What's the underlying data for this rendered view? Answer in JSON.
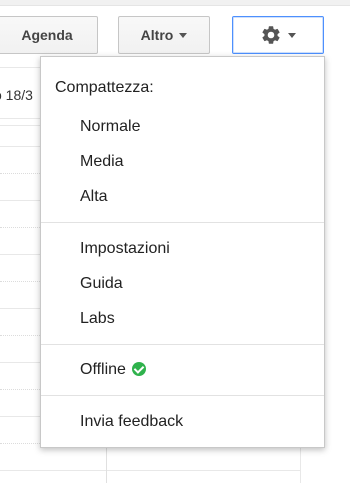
{
  "toolbar": {
    "agenda_label": "Agenda",
    "altro_label": "Altro",
    "settings_icon": "gear-icon"
  },
  "calendar": {
    "date_label": "o 18/3"
  },
  "settings_menu": {
    "compactness_heading": "Compattezza:",
    "density_options": [
      "Normale",
      "Media",
      "Alta"
    ],
    "settings_item": "Impostazioni",
    "help_item": "Guida",
    "labs_item": "Labs",
    "offline_item": "Offline",
    "offline_status_icon": "check-circle-icon",
    "feedback_item": "Invia feedback"
  },
  "colors": {
    "accent_border": "#4d90fe",
    "offline_check": "#2fb24c"
  }
}
